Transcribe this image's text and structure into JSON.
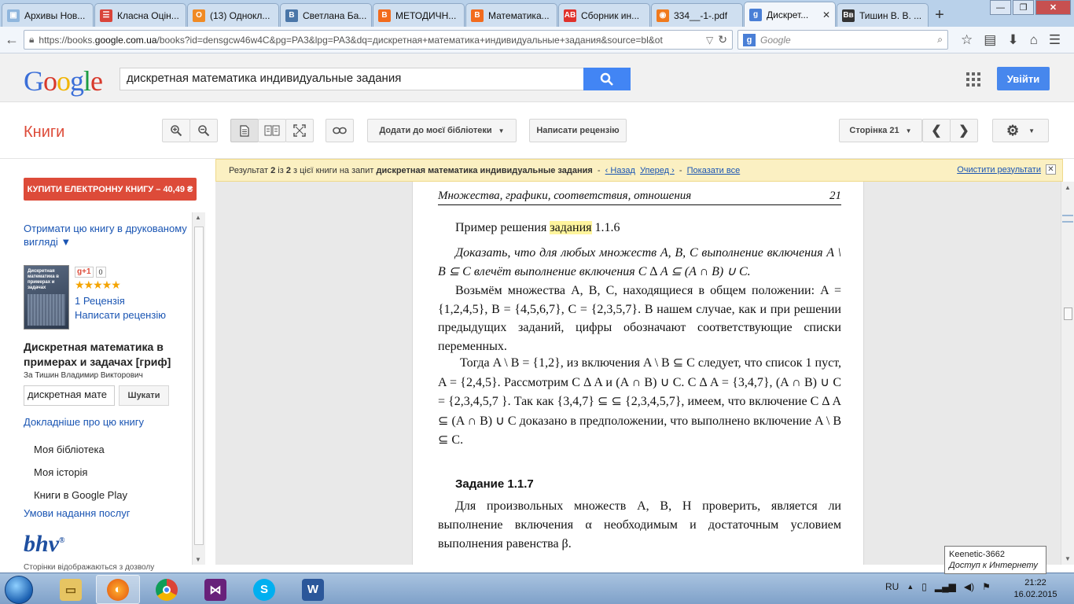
{
  "browser": {
    "tabs": [
      {
        "label": "Архивы Нов...",
        "color": "#8fb6dd",
        "glyph": "▣"
      },
      {
        "label": "Класна Оцін...",
        "color": "#d9443a",
        "glyph": "☰"
      },
      {
        "label": "(13) Однокл...",
        "color": "#f08a24",
        "glyph": "О"
      },
      {
        "label": "Светлана Ба...",
        "color": "#4a76a8",
        "glyph": "B"
      },
      {
        "label": "МЕТОДИЧН...",
        "color": "#f26b1d",
        "glyph": "B"
      },
      {
        "label": "Математика...",
        "color": "#f26b1d",
        "glyph": "B"
      },
      {
        "label": "Сборник ин...",
        "color": "#e0312b",
        "glyph": "AB"
      },
      {
        "label": "334__-1-.pdf",
        "color": "#f07a1d",
        "glyph": "◉"
      },
      {
        "label": "Дискрет...",
        "color": "#4a7fd6",
        "glyph": "g"
      },
      {
        "label": "Тишин В. В. ...",
        "color": "#333333",
        "glyph": "Вв"
      }
    ],
    "active_tab": 8,
    "new_tab": "+",
    "url_prefix": "https://books.",
    "url_domain": "google.com.ua",
    "url_rest": "/books?id=densgcw46w4C&pg=PA3&lpg=PA3&dq=дискретная+математика+индивидуальные+задания&source=bl&ot",
    "search_placeholder": "Google"
  },
  "google": {
    "logo": [
      "G",
      "o",
      "o",
      "g",
      "l",
      "e"
    ],
    "query": "дискретная математика индивидуальные задания",
    "signin": "Увійти"
  },
  "toolbar": {
    "section": "Книги",
    "add_library": "Додати до моєї бібліотеки",
    "write_review": "Написати рецензію",
    "page": "Сторінка 21"
  },
  "sidebar": {
    "buy": "КУПИТИ ЕЛЕКТРОННУ КНИГУ – 40,49 ₴",
    "print_link": "Отримати цю книгу в друкованому вигляді ▼",
    "cover_title": "Дискретная математика в примерах и задачах",
    "gplus": "g+1",
    "gplus_count": "0",
    "stars": "★★★★★",
    "reviews": "1 Рецензія",
    "write_review": "Написати рецензію",
    "book_title": "Дискретная математика в примерах и задачах [гриф]",
    "author": "За Тишин Владимир Викторович",
    "search_value": "дискретная мате",
    "search_button": "Шукати",
    "more": "Докладніше про цю книгу",
    "nav": [
      "Моя бібліотека",
      "Моя історія",
      "Книги в Google Play"
    ],
    "terms": "Умови надання послуг",
    "publisher_logo": "bhv",
    "footer": "Сторінки відображаються з дозволу"
  },
  "results": {
    "prefix": "Результат",
    "num": "2",
    "of": "із",
    "total": "2",
    "mid": "з цієї книги на запит",
    "query": "дискретная математика индивидуальные задания",
    "back": "‹ Назад",
    "forward": "Уперед ›",
    "show_all": "Показати все",
    "clear": "Очистити результати",
    "close": "✕"
  },
  "page": {
    "header": "Множества, графики, соответствия, отношения",
    "number": "21",
    "example_prefix": "Пример решения",
    "example_highlight": "задания",
    "example_suffix": "1.1.6",
    "p1": "Доказать, что для любых множеств  A, B, C выполнение включения  A \\ B ⊆ C влечёт выполнение включения C ∆ A ⊆ (A ∩ B) ∪ C.",
    "p2": "Возьмём множества  A,  B,  C,  находящиеся в общем положении:  A = {1,2,4,5},   B = {4,5,6,7},   C = {2,3,5,7}.   В нашем случае, как и при решении предыдущих заданий, цифры обозначают соответствующие списки переменных.",
    "p3": "Тогда  A \\ B = {1,2}, из включения  A \\ B ⊆ C следует, что список 1 пуст,  A = {2,4,5}.  Рассмотрим  C ∆ A  и  (A ∩ B) ∪ C.  C ∆ A = {3,4,7},   (A ∩ B) ∪ C = {2,3,4,5,7 }.   Так как {3,4,7}  ⊆ ⊆ {2,3,4,5,7}, имеем, что включение  C ∆ A ⊆ (A ∩ B) ∪ C доказано в предположении, что выполнено включение  A \\ B ⊆ C.",
    "task_heading": "Задание 1.1.7",
    "p4": "Для произвольных множеств  A,  B,  H проверить, является ли выполнение включения α необходимым и достаточным условием выполнения равенства β."
  },
  "tooltip": {
    "line1": "Keenetic-3662",
    "line2": "Доступ к Интернету"
  },
  "taskbar": {
    "lang": "RU",
    "time": "21:22",
    "date": "16.02.2015"
  }
}
